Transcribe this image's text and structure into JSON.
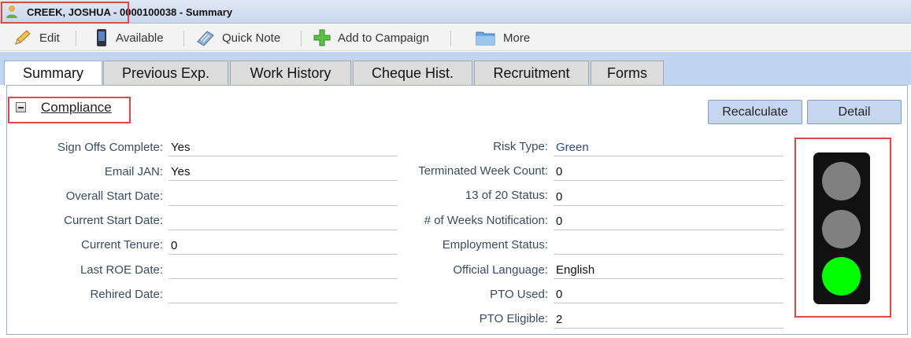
{
  "window": {
    "title": "CREEK, JOSHUA - 0000100038 - Summary"
  },
  "toolbar": {
    "edit_label": "Edit",
    "available_label": "Available",
    "quick_note_label": "Quick Note",
    "add_campaign_label": "Add to Campaign",
    "more_label": "More"
  },
  "tabs": [
    {
      "label": "Summary",
      "active": true
    },
    {
      "label": "Previous Exp.",
      "active": false
    },
    {
      "label": "Work History",
      "active": false
    },
    {
      "label": "Cheque Hist.",
      "active": false
    },
    {
      "label": "Recruitment",
      "active": false
    },
    {
      "label": "Forms",
      "active": false
    }
  ],
  "compliance": {
    "title": "Compliance",
    "recalculate_label": "Recalculate",
    "detail_label": "Detail",
    "left_fields": [
      {
        "label": "Sign Offs Complete:",
        "value": "Yes"
      },
      {
        "label": "Email JAN:",
        "value": "Yes"
      },
      {
        "label": "Overall Start Date:",
        "value": ""
      },
      {
        "label": "Current Start Date:",
        "value": ""
      },
      {
        "label": "Current Tenure:",
        "value": "0"
      },
      {
        "label": "Last ROE Date:",
        "value": ""
      },
      {
        "label": "Rehired Date:",
        "value": ""
      }
    ],
    "right_fields": [
      {
        "label": "Risk Type:",
        "value": "Green"
      },
      {
        "label": "Terminated Week Count:",
        "value": "0"
      },
      {
        "label": "13 of 20 Status:",
        "value": "0"
      },
      {
        "label": "# of Weeks Notification:",
        "value": "0"
      },
      {
        "label": "Employment Status:",
        "value": ""
      },
      {
        "label": "Official Language:",
        "value": "English"
      },
      {
        "label": "PTO Used:",
        "value": "0"
      },
      {
        "label": "PTO Eligible:",
        "value": "2"
      }
    ]
  },
  "traffic_light": {
    "active_lamp": "green",
    "colors": {
      "off": "#808080",
      "green": "#00ff00"
    }
  },
  "colors": {
    "highlight": "#e04848",
    "tab_strip": "#c2d5f0",
    "button": "#c6d6ef"
  }
}
